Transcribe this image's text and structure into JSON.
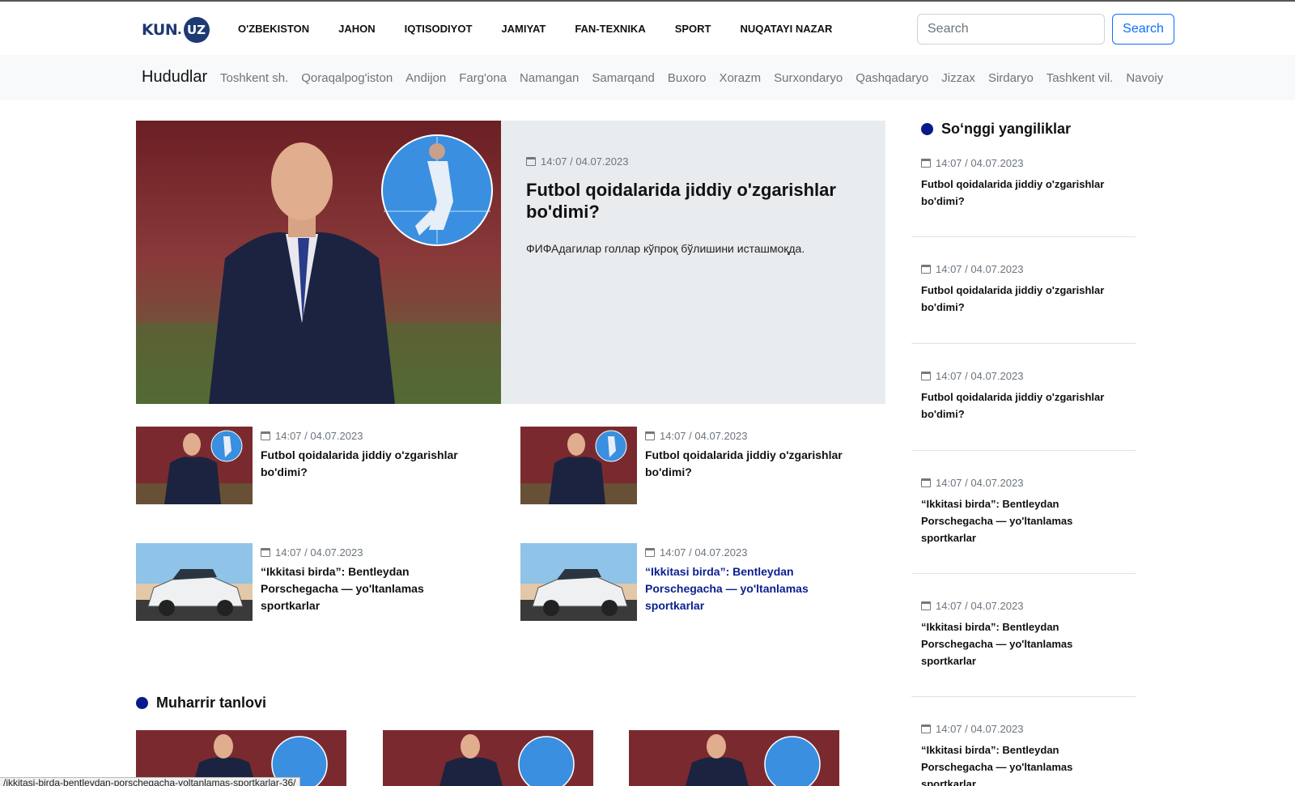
{
  "site": {
    "logo_text": "KUN",
    "logo_badge": "UZ"
  },
  "nav": {
    "items": [
      "O'ZBEKISTON",
      "JAHON",
      "IQTISODIYOT",
      "JAMIYAT",
      "FAN-TEXNIKA",
      "SPORT",
      "NUQATAYI NAZAR"
    ]
  },
  "search": {
    "placeholder": "Search",
    "button_label": "Search"
  },
  "regions": {
    "title": "Hududlar",
    "items": [
      "Toshkent sh.",
      "Qoraqalpog'iston",
      "Andijon",
      "Farg'ona",
      "Namangan",
      "Samarqand",
      "Buxoro",
      "Xorazm",
      "Surxondaryo",
      "Qashqadaryo",
      "Jizzax",
      "Sirdaryo",
      "Tashkent vil.",
      "Navoiy"
    ]
  },
  "featured": {
    "date": "14:07 / 04.07.2023",
    "title": "Futbol qoidalarida jiddiy o'zgarishlar bo'dimi?",
    "lead": "ФИФАдагилар голлар кўпроқ бўлишини исташмоқда."
  },
  "cards": [
    {
      "date": "14:07 / 04.07.2023",
      "title": "Futbol qoidalarida jiddiy o'zgarishlar bo'dimi?",
      "image": "fifa-president"
    },
    {
      "date": "14:07 / 04.07.2023",
      "title": "Futbol qoidalarida jiddiy o'zgarishlar bo'dimi?",
      "image": "fifa-president"
    },
    {
      "date": "14:07 / 04.07.2023",
      "title": "“Ikkitasi birda”: Bentleydan Porschegacha — yo'ltanlamas sportkarlar",
      "image": "sportscar"
    },
    {
      "date": "14:07 / 04.07.2023",
      "title": "“Ikkitasi birda”: Bentleydan Porschegacha — yo'ltanlamas sportkarlar",
      "image": "sportscar",
      "hovered": true
    }
  ],
  "latest": {
    "title": "So‘nggi yangiliklar",
    "items": [
      {
        "date": "14:07 / 04.07.2023",
        "title": "Futbol qoidalarida jiddiy o'zgarishlar bo'dimi?"
      },
      {
        "date": "14:07 / 04.07.2023",
        "title": "Futbol qoidalarida jiddiy o'zgarishlar bo'dimi?"
      },
      {
        "date": "14:07 / 04.07.2023",
        "title": "Futbol qoidalarida jiddiy o'zgarishlar bo'dimi?"
      },
      {
        "date": "14:07 / 04.07.2023",
        "title": "“Ikkitasi birda”: Bentleydan Porschegacha — yo'ltanlamas sportkarlar"
      },
      {
        "date": "14:07 / 04.07.2023",
        "title": "“Ikkitasi birda”: Bentleydan Porschegacha — yo'ltanlamas sportkarlar"
      },
      {
        "date": "14:07 / 04.07.2023",
        "title": "“Ikkitasi birda”: Bentleydan Porschegacha — yo'ltanlamas sportkarlar"
      }
    ]
  },
  "editor": {
    "title": "Muharrir tanlovi"
  },
  "status_bar": {
    "url": "/ikkitasi-birda-bentleydan-porschegacha-yoltanlamas-sportkarlar-36/"
  },
  "colors": {
    "accent_dot": "#0a1a8a",
    "link_hover": "#0a1f8f",
    "search_button": "#0d6efd",
    "featured_bg": "#e9ecef"
  }
}
